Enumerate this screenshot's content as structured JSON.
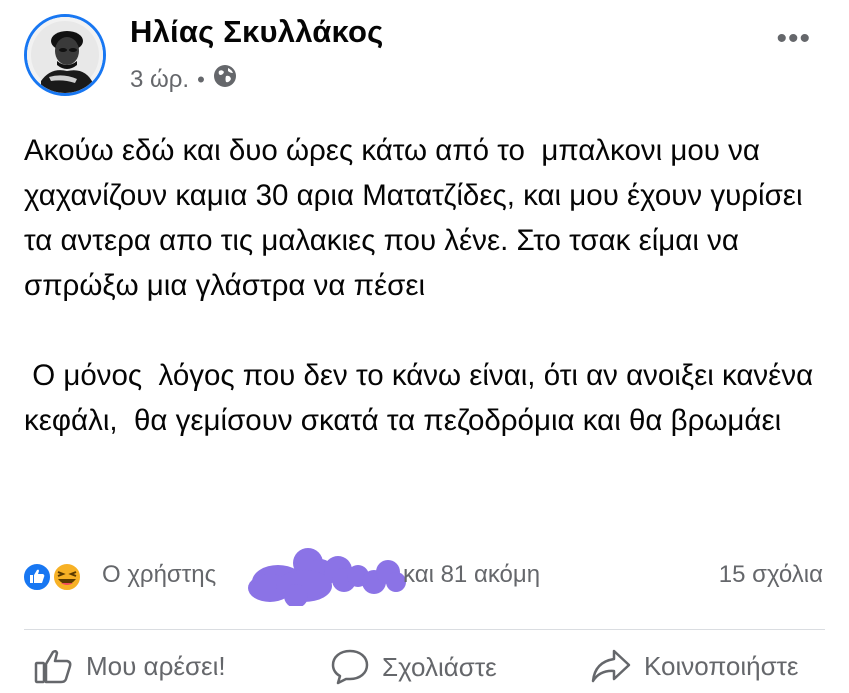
{
  "post": {
    "author": "Ηλίας Σκυλλάκος",
    "time": "3 ώρ.",
    "separator": "•",
    "privacy_icon": "globe-icon",
    "more_icon": "more-options-icon",
    "more_label": "•••",
    "paragraphs": [
      "Ακούω εδώ και δυο ώρες κάτω από το  μπαλκονι μου να χαχανίζουν καμια 30 αρια Ματατζίδες, και μου έχουν γυρίσει τα αντερα απο τις μαλακιες που λένε. Στο τσακ είμαι να σπρώξω μια γλάστρα να πέσει",
      " Ο μόνος  λόγος που δεν το κάνω είναι, ότι αν ανοιξει κανένα κεφάλι,  θα γεμίσουν σκατά τα πεζοδρόμια και θα βρωμάει"
    ]
  },
  "reactions": {
    "icons": [
      "like-reaction-icon",
      "haha-reaction-icon"
    ],
    "prefix": "Ο χρήστης",
    "suffix": "και 81 ακόμη",
    "comments": "15 σχόλια",
    "like_color": "#1877f2",
    "haha_color": "#f7b125",
    "redaction_color": "#8b73e6"
  },
  "actions": [
    {
      "icon": "thumbs-up-icon",
      "label": "Μου αρέσει!"
    },
    {
      "icon": "comment-icon",
      "label": "Σχολιάστε"
    },
    {
      "icon": "share-icon",
      "label": "Κοινοποιήστε"
    }
  ]
}
